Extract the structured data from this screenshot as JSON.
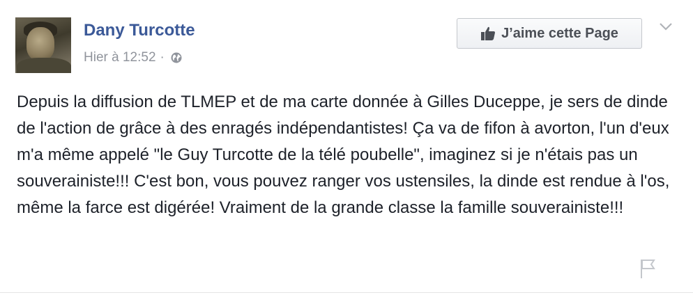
{
  "post": {
    "author": "Dany Turcotte",
    "timestamp": "Hier à 12:52",
    "separator": "·",
    "privacy_icon": "globe-icon",
    "like_page_label": "J’aime cette Page",
    "menu_icon": "chevron-down-icon",
    "text": "Depuis la diffusion de TLMEP et de ma carte donnée à Gilles Duceppe, je sers de dinde de l'action de grâce à des enragés indépendantistes! Ça va de fifon à avorton, l'un d'eux m'a même appelé \"le Guy Turcotte de la télé poubelle\", imaginez si je n'étais pas un souverainiste!!! C'est bon, vous pouvez ranger vos ustensiles, la dinde est rendue à l'os, même la farce est digérée! Vraiment de la grande classe la famille souverainiste!!!",
    "report_icon": "flag-icon"
  },
  "colors": {
    "author_blue": "#3b5998",
    "meta_gray": "#90949c",
    "text": "#1d2129",
    "button_text": "#4b4f56"
  }
}
